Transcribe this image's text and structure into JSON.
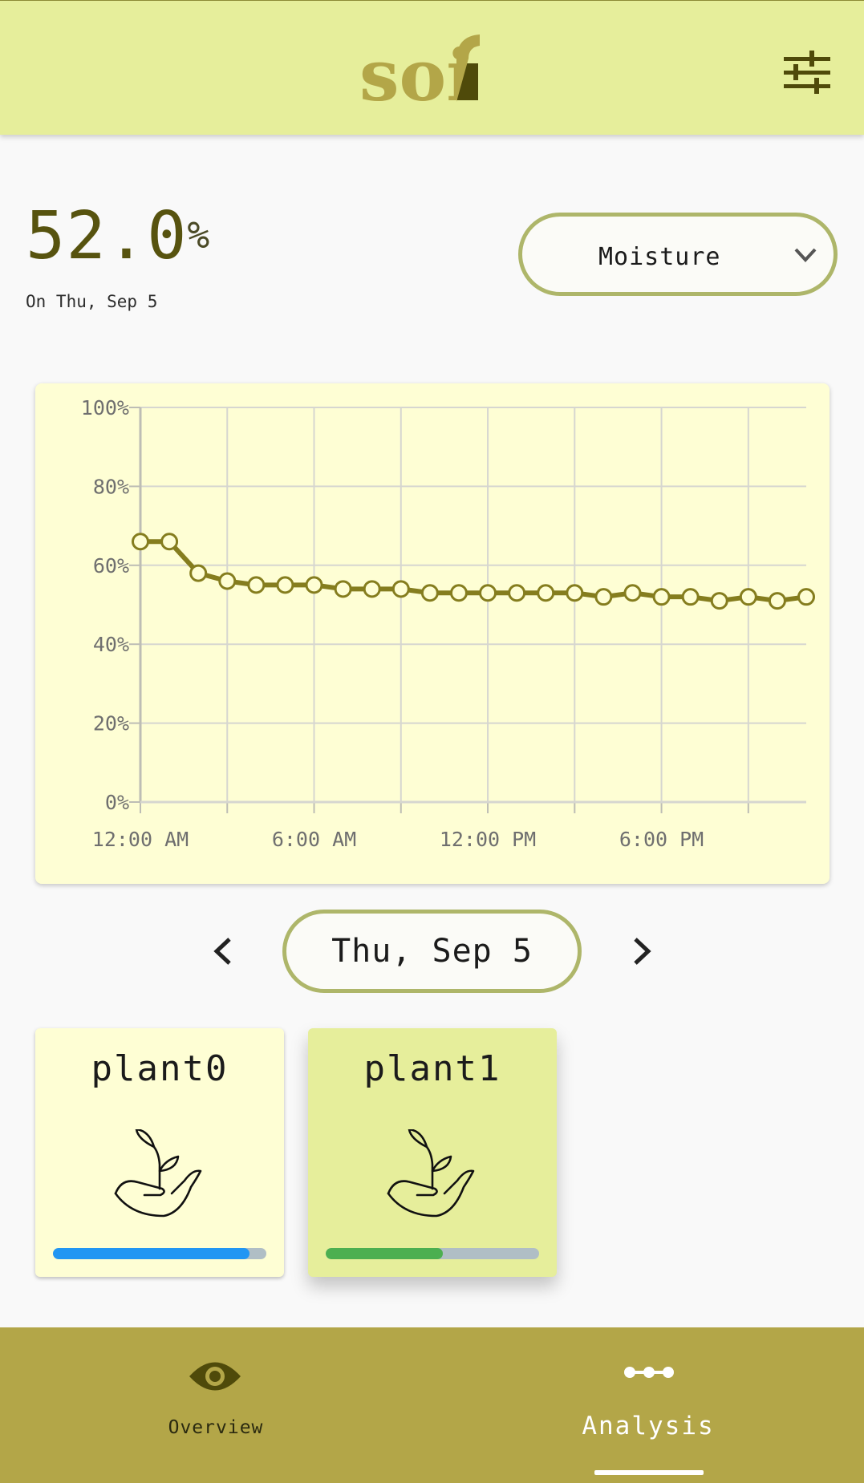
{
  "app": {
    "logo_text": "soif"
  },
  "header": {
    "filter_icon": "sliders-icon"
  },
  "reading": {
    "value": "52.0",
    "unit": "%",
    "date_label": "On Thu, Sep 5"
  },
  "metric_select": {
    "selected": "Moisture",
    "icon": "chevron-down-icon"
  },
  "chart_data": {
    "type": "line",
    "x_unit": "hour",
    "x": [
      0,
      1,
      2,
      3,
      4,
      5,
      6,
      7,
      8,
      9,
      10,
      11,
      12,
      13,
      14,
      15,
      16,
      17,
      18,
      19,
      20,
      21,
      22,
      23
    ],
    "series": [
      {
        "values": [
          66,
          66,
          58,
          56,
          55,
          55,
          55,
          54,
          54,
          54,
          53,
          53,
          53,
          53,
          53,
          53,
          52,
          53,
          52,
          52,
          51,
          52,
          51,
          52
        ]
      }
    ],
    "ylim": [
      0,
      100
    ],
    "xlim": [
      0,
      23
    ],
    "y_ticks": [
      "0%",
      "20%",
      "40%",
      "60%",
      "80%",
      "100%"
    ],
    "y_tick_values": [
      0,
      20,
      40,
      60,
      80,
      100
    ],
    "x_ticks": [
      "12:00 AM",
      "6:00 AM",
      "12:00 PM",
      "6:00 PM"
    ],
    "x_tick_values": [
      0,
      6,
      12,
      18
    ],
    "x_grid_values": [
      0,
      3,
      6,
      9,
      12,
      15,
      18,
      21
    ],
    "grid": true,
    "line_color": "#857d1e"
  },
  "date_nav": {
    "label": "Thu, Sep 5",
    "prev_icon": "chevron-left-icon",
    "next_icon": "chevron-right-icon"
  },
  "plants": [
    {
      "name": "plant0",
      "level": 0.92,
      "bar_color": "#2196f3",
      "selected": false,
      "icon": "seedling-hand-icon"
    },
    {
      "name": "plant1",
      "level": 0.55,
      "bar_color": "#4caf50",
      "selected": true,
      "icon": "seedling-hand-icon"
    }
  ],
  "bottom_nav": {
    "items": [
      {
        "label": "Overview",
        "icon": "eye-icon",
        "active": false
      },
      {
        "label": "Analysis",
        "icon": "timeline-dots-icon",
        "active": true
      }
    ]
  },
  "colors": {
    "header_bg": "#e6ee9b",
    "nav_bg": "#b3a648",
    "accent": "#857d1e",
    "chart_bg": "#fefed4"
  }
}
